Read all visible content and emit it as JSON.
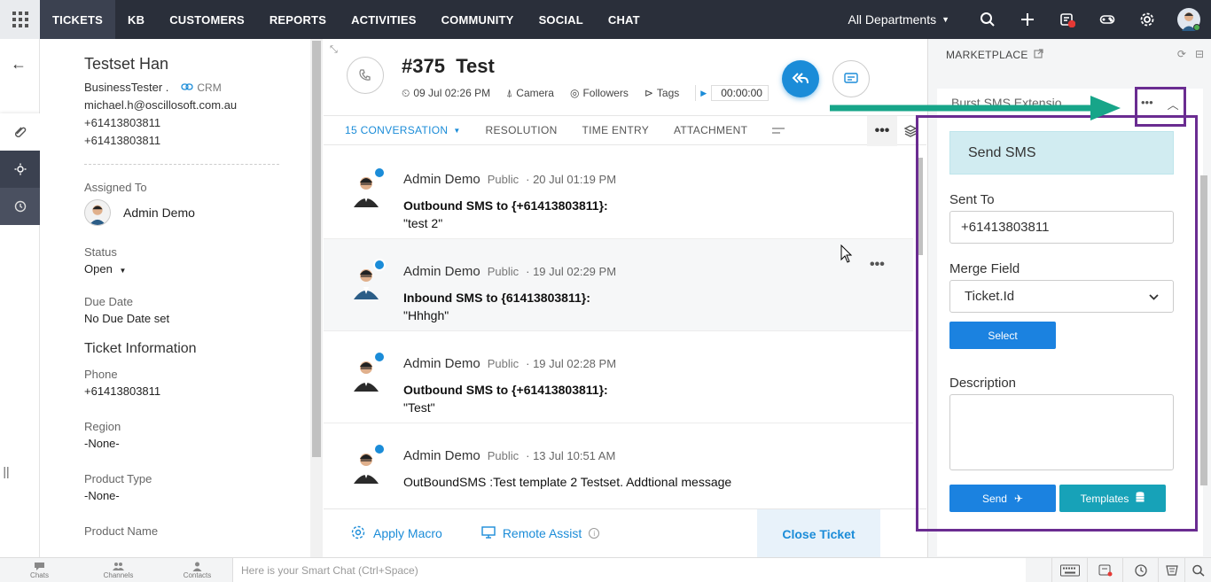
{
  "nav": {
    "items": [
      "TICKETS",
      "KB",
      "CUSTOMERS",
      "REPORTS",
      "ACTIVITIES",
      "COMMUNITY",
      "SOCIAL",
      "CHAT"
    ],
    "department": "All Departments",
    "icons": [
      "search-icon",
      "plus-icon",
      "notifications-icon",
      "gamepad-icon",
      "gear-icon"
    ]
  },
  "contact": {
    "name": "Testset Han",
    "company": "BusinessTester .",
    "crm": "CRM",
    "email": "michael.h@oscillosoft.com.au",
    "phone1": "+61413803811",
    "phone2": "+61413803811",
    "assigned_label": "Assigned To",
    "assignee": "Admin Demo",
    "status_label": "Status",
    "status": "Open",
    "due_label": "Due Date",
    "due": "No Due Date set",
    "info_title": "Ticket Information",
    "phone_label": "Phone",
    "phone": "+61413803811",
    "region_label": "Region",
    "region": "-None-",
    "ptype_label": "Product Type",
    "ptype": "-None-",
    "pname_label": "Product Name"
  },
  "ticket": {
    "number": "#375",
    "subject": "Test",
    "created": "09 Jul 02:26 PM",
    "channel": "Camera",
    "followers": "Followers",
    "tags": "Tags",
    "timer": "00:00:00",
    "tabs": {
      "conversation": "15 CONVERSATION",
      "resolution": "RESOLUTION",
      "time_entry": "TIME ENTRY",
      "attachment": "ATTACHMENT"
    },
    "threads": [
      {
        "author": "Admin Demo",
        "visibility": "Public",
        "date": "20 Jul 01:19 PM",
        "line1": "Outbound SMS to {+61413803811}:",
        "line2": "\"test 2\""
      },
      {
        "author": "Admin Demo",
        "visibility": "Public",
        "date": "19 Jul 02:29 PM",
        "line1": "Inbound SMS to {61413803811}:",
        "line2": "\"Hhhgh\""
      },
      {
        "author": "Admin Demo",
        "visibility": "Public",
        "date": "19 Jul 02:28 PM",
        "line1": "Outbound SMS to {+61413803811}:",
        "line2": "\"Test\""
      },
      {
        "author": "Admin Demo",
        "visibility": "Public",
        "date": "13 Jul 10:51 AM",
        "line1": "OutBoundSMS :Test template 2 Testset. Addtional message",
        "line2": ""
      }
    ],
    "footer": {
      "macro": "Apply Macro",
      "remote": "Remote Assist",
      "close": "Close Ticket"
    }
  },
  "marketplace": {
    "title": "MARKETPLACE",
    "extension_title": "Burst SMS Extensio",
    "form": {
      "heading": "Send SMS",
      "sent_to_label": "Sent To",
      "sent_to_value": "+61413803811",
      "merge_label": "Merge Field",
      "merge_value": "Ticket.Id",
      "select_btn": "Select",
      "desc_label": "Description",
      "send_btn": "Send",
      "templates_btn": "Templates"
    }
  },
  "bottombar": {
    "chats": "Chats",
    "channels": "Channels",
    "contacts": "Contacts",
    "smartchat_placeholder": "Here is your Smart Chat (Ctrl+Space)"
  },
  "colors": {
    "accent": "#1b8cd8",
    "nav_bg": "#2a2f3a",
    "annotation": "#6a2c91",
    "arrow": "#17a589"
  }
}
